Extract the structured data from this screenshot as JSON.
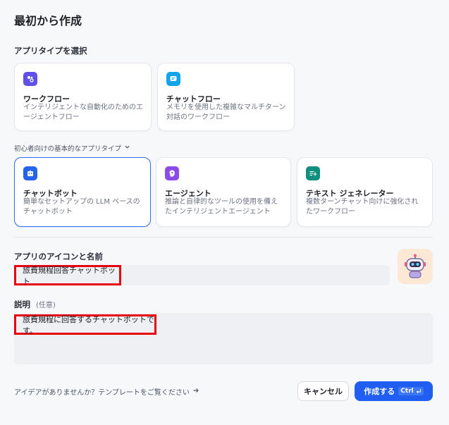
{
  "page": {
    "title": "最初から作成"
  },
  "app_type": {
    "label": "アプリタイプを選択",
    "cards": [
      {
        "title": "ワークフロー",
        "desc": "インテリジェントな自動化のためのエージェントフロー"
      },
      {
        "title": "チャットフロー",
        "desc": "メモリを使用した複雑なマルチターン対話のワークフロー"
      }
    ]
  },
  "basic": {
    "toggle_label": "初心者向けの基本的なアプリタイプ",
    "cards": [
      {
        "title": "チャットボット",
        "desc": "簡単なセットアップの LLM ベースのチャットボット"
      },
      {
        "title": "エージェント",
        "desc": "推論と自律的なツールの使用を備えたインテリジェントエージェント"
      },
      {
        "title": "テキスト ジェネレーター",
        "desc": "複数ターンチャット向けに強化されたワークフロー"
      }
    ]
  },
  "name_section": {
    "label": "アプリのアイコンと名前",
    "value": "旅費規程回答チャットボット"
  },
  "desc_section": {
    "label": "説明",
    "optional": "(任意)",
    "value": "旅費規程に回答するチャットボットです。"
  },
  "footer": {
    "idea_link": "アイデアがありませんか？テンプレートをご覧ください",
    "cancel": "キャンセル",
    "create": "作成する",
    "shortcut": "Ctrl"
  },
  "colors": {
    "accent": "#1f5ef0",
    "highlight": "#e60012",
    "workflow_icon": "#6150e8",
    "chatflow_icon": "#12a3e8",
    "chatbot_icon": "#2563eb",
    "agent_icon": "#8a4be8",
    "textgen_icon": "#0f8f7e"
  }
}
